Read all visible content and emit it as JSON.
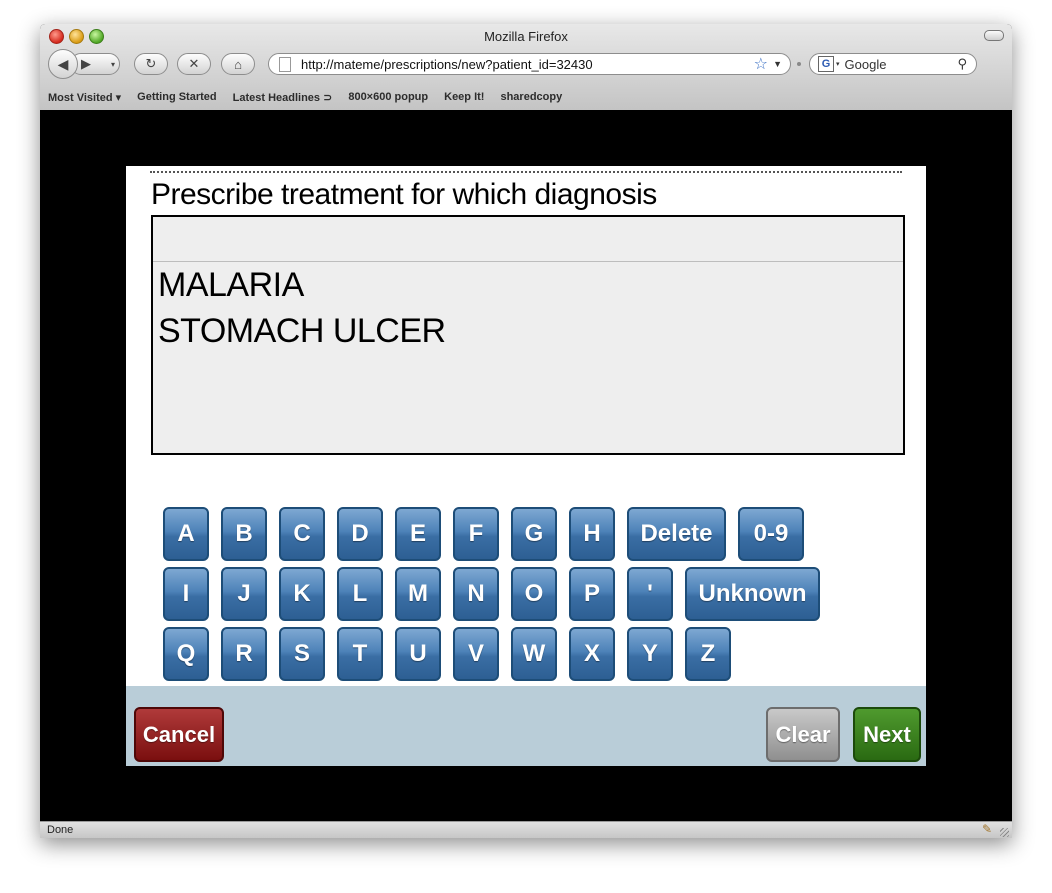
{
  "window": {
    "title": "Mozilla Firefox"
  },
  "toolbar": {
    "url": "http://mateme/prescriptions/new?patient_id=32430",
    "search_placeholder": "Google",
    "back_glyph": "◀",
    "forward_glyph": "▶",
    "reload_glyph": "↻",
    "stop_glyph": "✕",
    "home_glyph": "⌂"
  },
  "bookmarks": [
    "Most Visited ▾",
    "Getting Started",
    "Latest Headlines ⊃",
    "800×600 popup",
    "Keep It!",
    "sharedcopy"
  ],
  "question": "Prescribe treatment for which diagnosis",
  "input_value": "",
  "options": [
    "MALARIA",
    "STOMACH ULCER"
  ],
  "keyboard": {
    "row1": [
      "A",
      "B",
      "C",
      "D",
      "E",
      "F",
      "G",
      "H",
      "Delete",
      "0-9"
    ],
    "row2": [
      "I",
      "J",
      "K",
      "L",
      "M",
      "N",
      "O",
      "P",
      "'",
      "Unknown"
    ],
    "row3": [
      "Q",
      "R",
      "S",
      "T",
      "U",
      "V",
      "W",
      "X",
      "Y",
      "Z"
    ]
  },
  "buttons": {
    "cancel": "Cancel",
    "clear": "Clear",
    "next": "Next"
  },
  "status": "Done",
  "colors": {
    "key_blue": "#3a6ea4",
    "cancel_red": "#8a1a1a",
    "clear_gray": "#a8a8a8",
    "next_green": "#3a7d20",
    "bottom_bar": "#b9cdd8"
  }
}
